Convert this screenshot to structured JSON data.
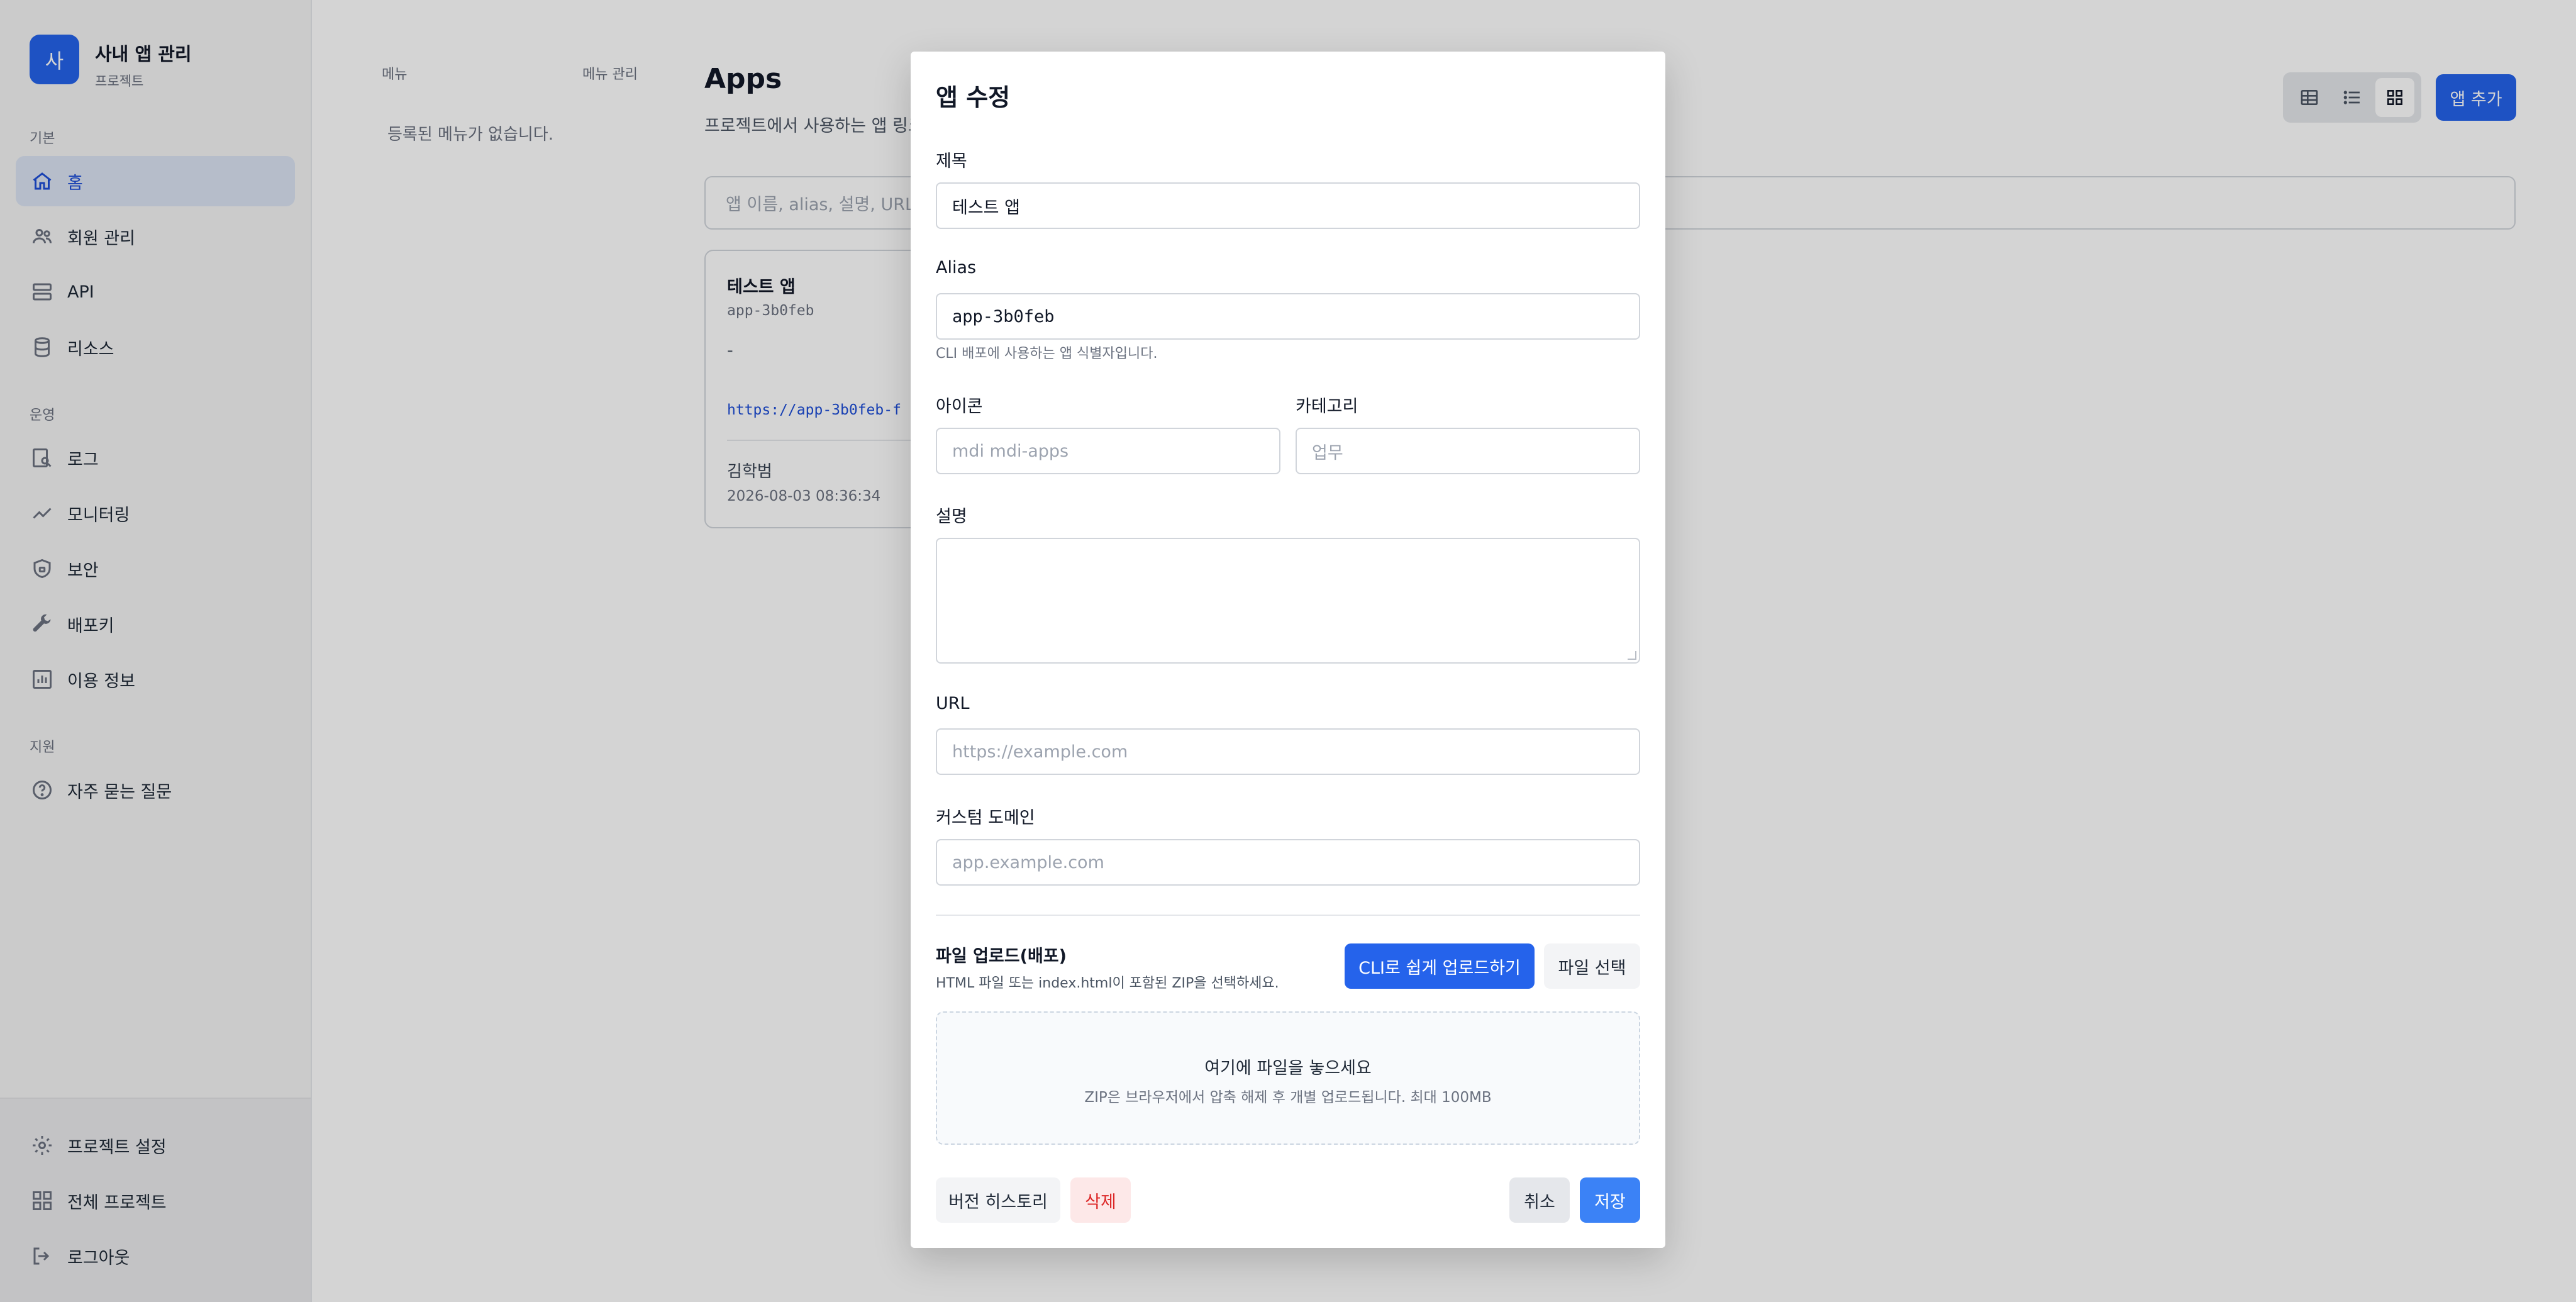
{
  "sidebar": {
    "brand": {
      "logo_letter": "사",
      "title": "사내 앱 관리",
      "subtitle": "프로젝트"
    },
    "sections": {
      "basic": "기본",
      "ops": "운영",
      "support": "지원"
    },
    "items": {
      "home": "홈",
      "members": "회원 관리",
      "api": "API",
      "resources": "리소스",
      "logs": "로그",
      "monitoring": "모니터링",
      "security": "보안",
      "deploy_key": "배포키",
      "usage": "이용 정보",
      "faq": "자주 묻는 질문",
      "project_settings": "프로젝트 설정",
      "all_projects": "전체 프로젝트",
      "logout": "로그아웃"
    },
    "active_item": "home"
  },
  "main": {
    "menu_col_label": "메뉴",
    "menu_manage_label": "메뉴 관리",
    "empty_menu": "등록된 메뉴가 없습니다.",
    "title": "Apps",
    "description": "프로젝트에서 사용하는 앱 링크",
    "search_placeholder": "앱 이름, alias, 설명, URL",
    "add_app": "앱 추가",
    "card": {
      "title": "테스트 앱",
      "alias": "app-3b0feb",
      "description": "-",
      "url": "https://app-3b0feb-f",
      "owner": "김학범",
      "date": "2026-08-03 08:36:34"
    }
  },
  "modal": {
    "title": "앱 수정",
    "fields": {
      "title_label": "제목",
      "title_value": "테스트 앱",
      "alias_label": "Alias",
      "alias_value": "app-3b0feb",
      "alias_hint": "CLI 배포에 사용하는 앱 식별자입니다.",
      "icon_label": "아이콘",
      "icon_placeholder": "mdi mdi-apps",
      "category_label": "카테고리",
      "category_placeholder": "업무",
      "desc_label": "설명",
      "url_label": "URL",
      "url_placeholder": "https://example.com",
      "domain_label": "커스텀 도메인",
      "domain_placeholder": "app.example.com"
    },
    "upload": {
      "title": "파일 업로드(배포)",
      "hint": "HTML 파일 또는 index.html이 포함된 ZIP을 선택하세요.",
      "cli_button": "CLI로 쉽게 업로드하기",
      "choose_button": "파일 선택",
      "drop_title": "여기에 파일을 놓으세요",
      "drop_sub": "ZIP은 브라우저에서 압축 해제 후 개별 업로드됩니다. 최대 100MB"
    },
    "footer": {
      "history": "버전 히스토리",
      "delete": "삭제",
      "cancel": "취소",
      "save": "저장"
    }
  }
}
